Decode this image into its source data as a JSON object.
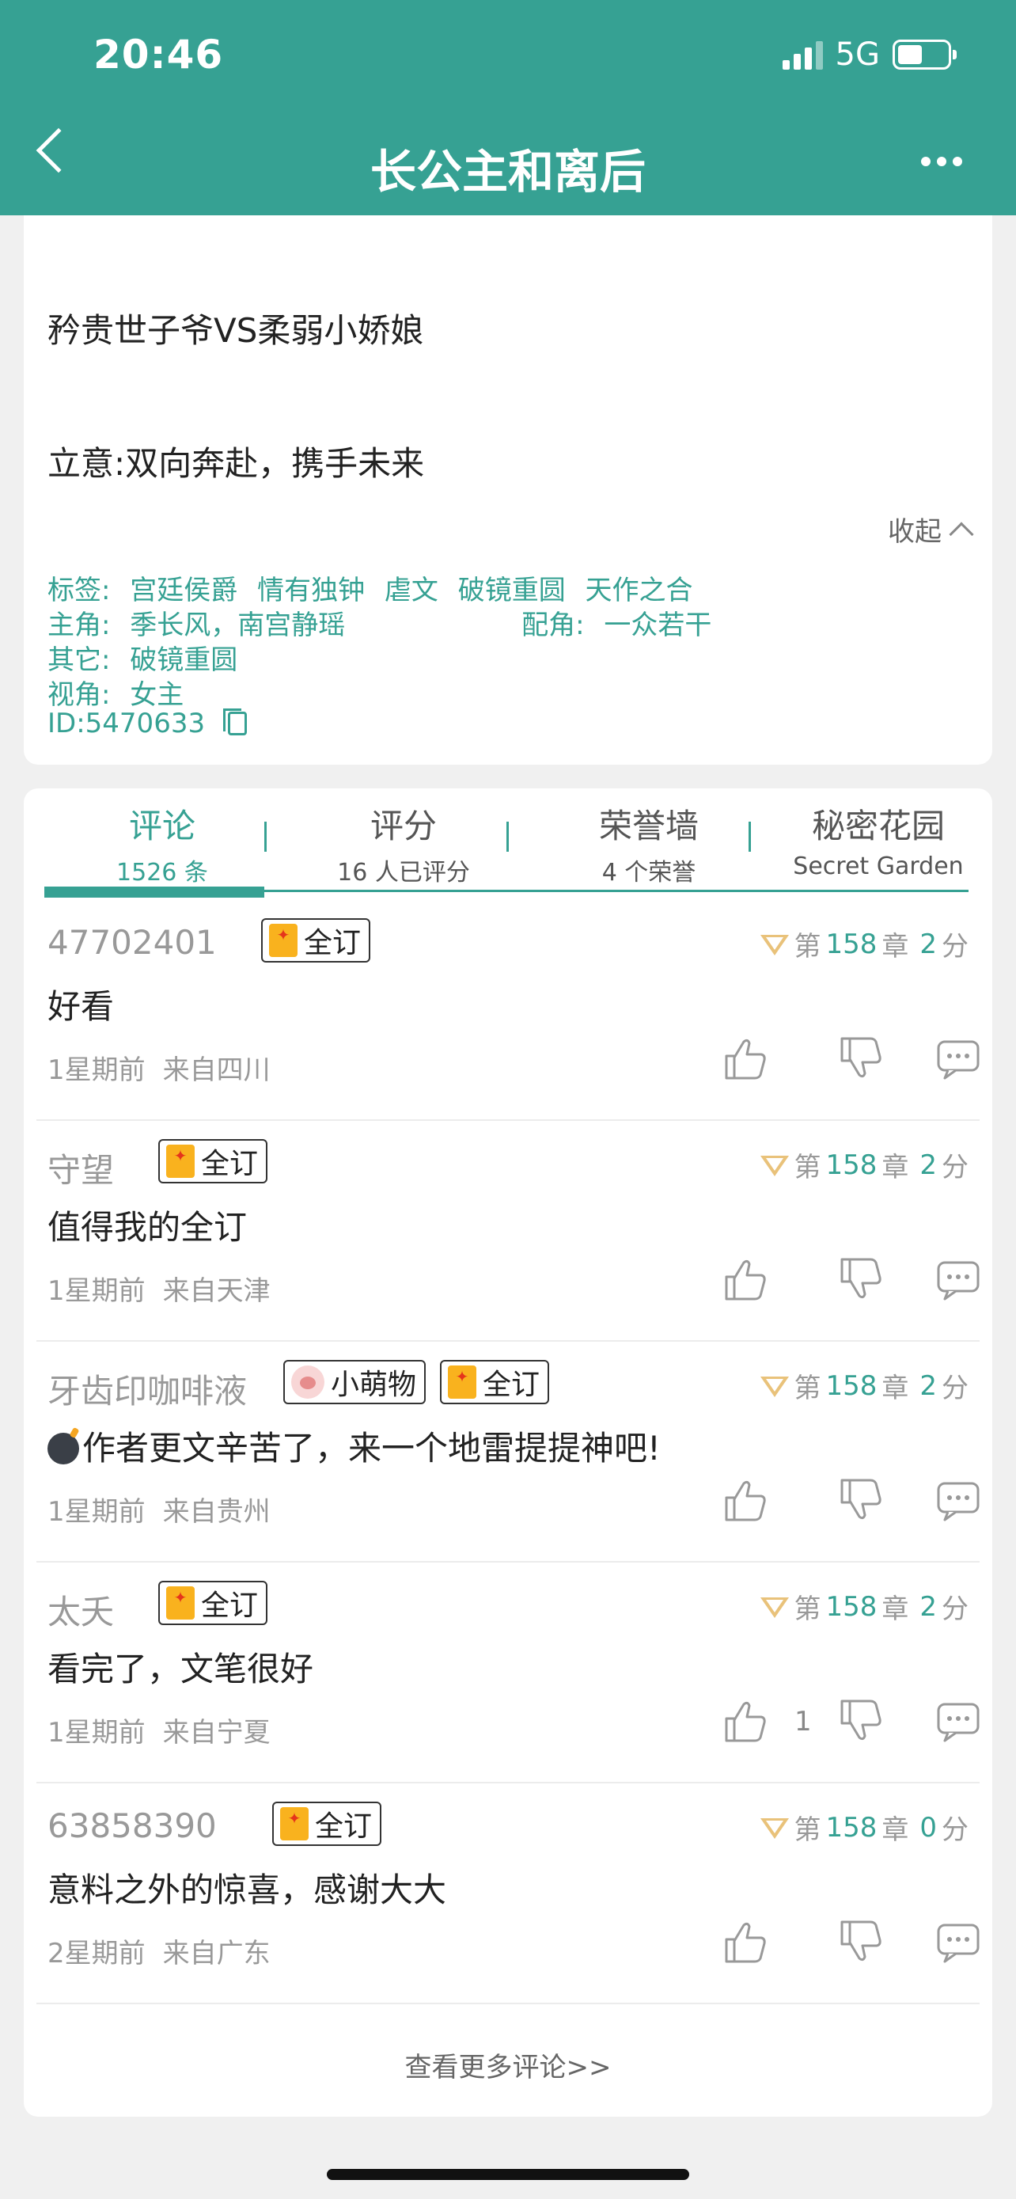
{
  "status": {
    "time": "20:46",
    "network": "5G"
  },
  "header": {
    "title": "长公主和离后"
  },
  "summary": {
    "line1": "矜贵世子爷VS柔弱小娇娘",
    "line2": "立意:双向奔赴，携手未来",
    "collapse_label": "收起"
  },
  "meta": {
    "tags_label": "标签:",
    "tags": [
      "宫廷侯爵",
      "情有独钟",
      "虐文",
      "破镜重圆",
      "天作之合"
    ],
    "lead_label": "主角:",
    "lead": "季长风，南宫静瑶",
    "support_label": "配角:",
    "support": "一众若干",
    "other_label": "其它:",
    "other": "破镜重圆",
    "pov_label": "视角:",
    "pov": "女主",
    "id_text": "ID:5470633"
  },
  "tabs": [
    {
      "label": "评论",
      "sub": "1526 条"
    },
    {
      "label": "评分",
      "sub": "16 人已评分"
    },
    {
      "label": "荣誉墙",
      "sub": "4 个荣誉"
    },
    {
      "label": "秘密花园",
      "sub": "Secret Garden"
    }
  ],
  "comments": [
    {
      "user": "47702401",
      "badges": [
        {
          "type": "order",
          "label": "全订"
        }
      ],
      "chapter_prefix": "第",
      "chapter": "158",
      "chapter_suffix": "章",
      "score": "2",
      "score_unit": "分",
      "text": "好看",
      "time": "1星期前",
      "location": "来自四川",
      "likes": ""
    },
    {
      "user": "守望",
      "badges": [
        {
          "type": "order",
          "label": "全订"
        }
      ],
      "chapter_prefix": "第",
      "chapter": "158",
      "chapter_suffix": "章",
      "score": "2",
      "score_unit": "分",
      "text": "值得我的全订",
      "time": "1星期前",
      "location": "来自天津",
      "likes": ""
    },
    {
      "user": "牙齿印咖啡液",
      "badges": [
        {
          "type": "paw",
          "label": "小萌物"
        },
        {
          "type": "order",
          "label": "全订"
        }
      ],
      "chapter_prefix": "第",
      "chapter": "158",
      "chapter_suffix": "章",
      "score": "2",
      "score_unit": "分",
      "text": "作者更文辛苦了，来一个地雷提提神吧!",
      "bomb": true,
      "time": "1星期前",
      "location": "来自贵州",
      "likes": ""
    },
    {
      "user": "太夭",
      "badges": [
        {
          "type": "order",
          "label": "全订"
        }
      ],
      "chapter_prefix": "第",
      "chapter": "158",
      "chapter_suffix": "章",
      "score": "2",
      "score_unit": "分",
      "text": "看完了，文笔很好",
      "time": "1星期前",
      "location": "来自宁夏",
      "likes": "1"
    },
    {
      "user": "63858390",
      "badges": [
        {
          "type": "order",
          "label": "全订"
        }
      ],
      "chapter_prefix": "第",
      "chapter": "158",
      "chapter_suffix": "章",
      "score": "0",
      "score_unit": "分",
      "text": "意料之外的惊喜，感谢大大",
      "time": "2星期前",
      "location": "来自广东",
      "likes": ""
    }
  ],
  "more_comments": "查看更多评论>>",
  "colors": {
    "accent": "#36a193",
    "badge": "#f9b21e"
  }
}
